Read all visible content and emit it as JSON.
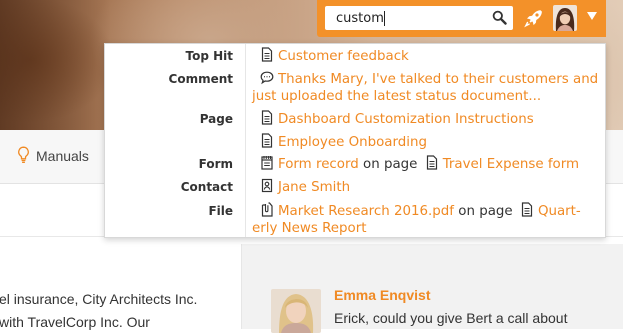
{
  "search": {
    "query": "custom"
  },
  "results": {
    "top_hit": {
      "category": "Top Hit",
      "title": "Customer feedback"
    },
    "comment": {
      "category": "Comment",
      "line1": "Thanks Mary, I've talked to their customers and",
      "line2": "just uploaded the latest status document..."
    },
    "page": {
      "category": "Page",
      "items": [
        "Dashboard Customization Instructions",
        "Employee Onboarding"
      ]
    },
    "form": {
      "category": "Form",
      "title": "Form record",
      "on_page": "on page",
      "page_title": "Travel Expense form"
    },
    "contact": {
      "category": "Contact",
      "name": "Jane Smith"
    },
    "file": {
      "category": "File",
      "title": "Market Research 2016.pdf",
      "on_page": "on page",
      "page_title_part1": "Quart-",
      "page_title_part2": "erly News Report"
    }
  },
  "nav": {
    "manuals_label": "Manuals"
  },
  "content": {
    "line1": "el insurance, City Architects Inc.",
    "line2": "with TravelCorp Inc. Our"
  },
  "comment_card": {
    "author": "Emma Enqvist",
    "text": "Erick, could you give Bert a call about"
  },
  "colors": {
    "accent": "#f39129",
    "link": "#f08a24"
  }
}
